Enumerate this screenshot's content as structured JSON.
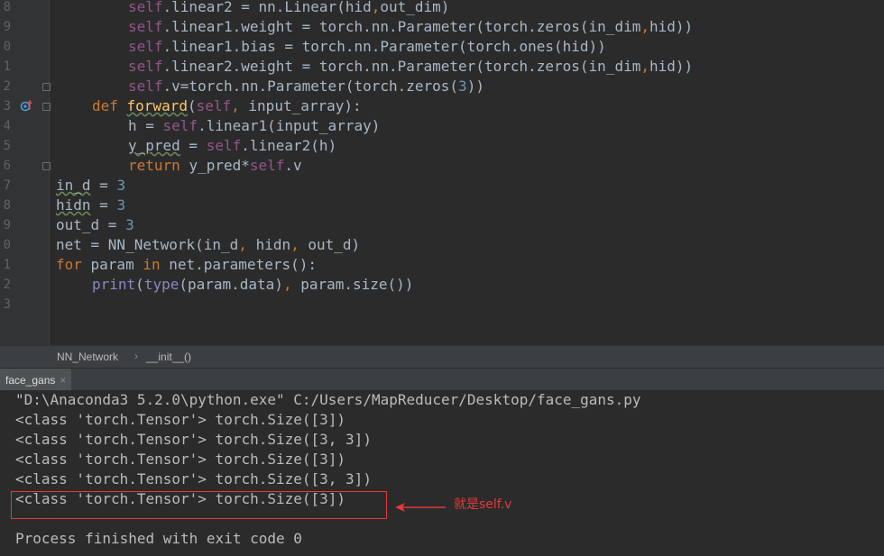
{
  "editor": {
    "line_numbers": [
      "8",
      "9",
      "0",
      "1",
      "2",
      "3",
      "4",
      "5",
      "6",
      "7",
      "8",
      "9",
      "0",
      "1",
      "2",
      "3"
    ],
    "lines": [
      {
        "indent": 8,
        "tokens": [
          {
            "t": "self",
            "c": "slf"
          },
          {
            "t": ".linear2 = nn.Linear(hid"
          },
          {
            "t": ",",
            "c": "kw"
          },
          {
            "t": "out_dim)"
          }
        ]
      },
      {
        "indent": 8,
        "tokens": [
          {
            "t": "self",
            "c": "slf"
          },
          {
            "t": ".linear1.weight = torch.nn.Parameter(torch.zeros(in_dim"
          },
          {
            "t": ",",
            "c": "kw"
          },
          {
            "t": "hid))"
          }
        ]
      },
      {
        "indent": 8,
        "tokens": [
          {
            "t": "self",
            "c": "slf"
          },
          {
            "t": ".linear1.bias = torch.nn.Parameter(torch.ones(hid))"
          }
        ]
      },
      {
        "indent": 8,
        "tokens": [
          {
            "t": "self",
            "c": "slf"
          },
          {
            "t": ".linear2.weight = torch.nn.Parameter(torch.zeros(in_dim"
          },
          {
            "t": ",",
            "c": "kw"
          },
          {
            "t": "hid))"
          }
        ]
      },
      {
        "indent": 8,
        "tokens": [
          {
            "t": "self",
            "c": "slf"
          },
          {
            "t": ".v=torch.nn.Parameter(torch.zeros("
          },
          {
            "t": "3",
            "c": "num"
          },
          {
            "t": "))"
          }
        ]
      },
      {
        "indent": 4,
        "tokens": [
          {
            "t": "def ",
            "c": "kw"
          },
          {
            "t": "forward",
            "c": "fn und"
          },
          {
            "t": "("
          },
          {
            "t": "self",
            "c": "slf"
          },
          {
            "t": ",",
            "c": "kw"
          },
          {
            "t": " input_array):"
          }
        ]
      },
      {
        "indent": 8,
        "tokens": [
          {
            "t": "h = "
          },
          {
            "t": "self",
            "c": "slf"
          },
          {
            "t": ".linear1(input_array)"
          }
        ]
      },
      {
        "indent": 8,
        "tokens": [
          {
            "t": "y_pred",
            "c": "und"
          },
          {
            "t": " = "
          },
          {
            "t": "self",
            "c": "slf"
          },
          {
            "t": ".linear2(h)"
          }
        ]
      },
      {
        "indent": 8,
        "tokens": [
          {
            "t": "return ",
            "c": "kw"
          },
          {
            "t": "y_pred*"
          },
          {
            "t": "self",
            "c": "slf"
          },
          {
            "t": ".v"
          }
        ]
      },
      {
        "indent": 0,
        "tokens": [
          {
            "t": "in_d",
            "c": "und"
          },
          {
            "t": " = "
          },
          {
            "t": "3",
            "c": "num"
          }
        ]
      },
      {
        "indent": 0,
        "tokens": [
          {
            "t": "hidn",
            "c": "und"
          },
          {
            "t": " = "
          },
          {
            "t": "3",
            "c": "num"
          }
        ]
      },
      {
        "indent": 0,
        "tokens": [
          {
            "t": "out_d = "
          },
          {
            "t": "3",
            "c": "num"
          }
        ]
      },
      {
        "indent": 0,
        "tokens": [
          {
            "t": "net = NN_Network(in_d"
          },
          {
            "t": ",",
            "c": "kw"
          },
          {
            "t": " hidn"
          },
          {
            "t": ",",
            "c": "kw"
          },
          {
            "t": " out_d)"
          }
        ]
      },
      {
        "indent": 0,
        "tokens": [
          {
            "t": "for ",
            "c": "kw"
          },
          {
            "t": "param "
          },
          {
            "t": "in ",
            "c": "kw"
          },
          {
            "t": "net.parameters():"
          }
        ]
      },
      {
        "indent": 4,
        "tokens": [
          {
            "t": "print",
            "c": "bi"
          },
          {
            "t": "("
          },
          {
            "t": "type",
            "c": "bi"
          },
          {
            "t": "(param.data)"
          },
          {
            "t": ",",
            "c": "kw"
          },
          {
            "t": " param.size())"
          }
        ]
      },
      {
        "indent": 0,
        "tokens": []
      }
    ]
  },
  "breadcrumb": {
    "class_name": "NN_Network",
    "separator": "›",
    "method_name": "__init__()"
  },
  "run_panel": {
    "tab_label": "face_gans",
    "tab_close": "×"
  },
  "console": {
    "lines": [
      "\"D:\\Anaconda3 5.2.0\\python.exe\" C:/Users/MapReducer/Desktop/face_gans.py",
      "<class 'torch.Tensor'> torch.Size([3])",
      "<class 'torch.Tensor'> torch.Size([3, 3])",
      "<class 'torch.Tensor'> torch.Size([3])",
      "<class 'torch.Tensor'> torch.Size([3, 3])",
      "<class 'torch.Tensor'> torch.Size([3])",
      "",
      "Process finished with exit code 0"
    ]
  },
  "annotation": {
    "text": "就是self.v",
    "color": "#e43b3b"
  }
}
